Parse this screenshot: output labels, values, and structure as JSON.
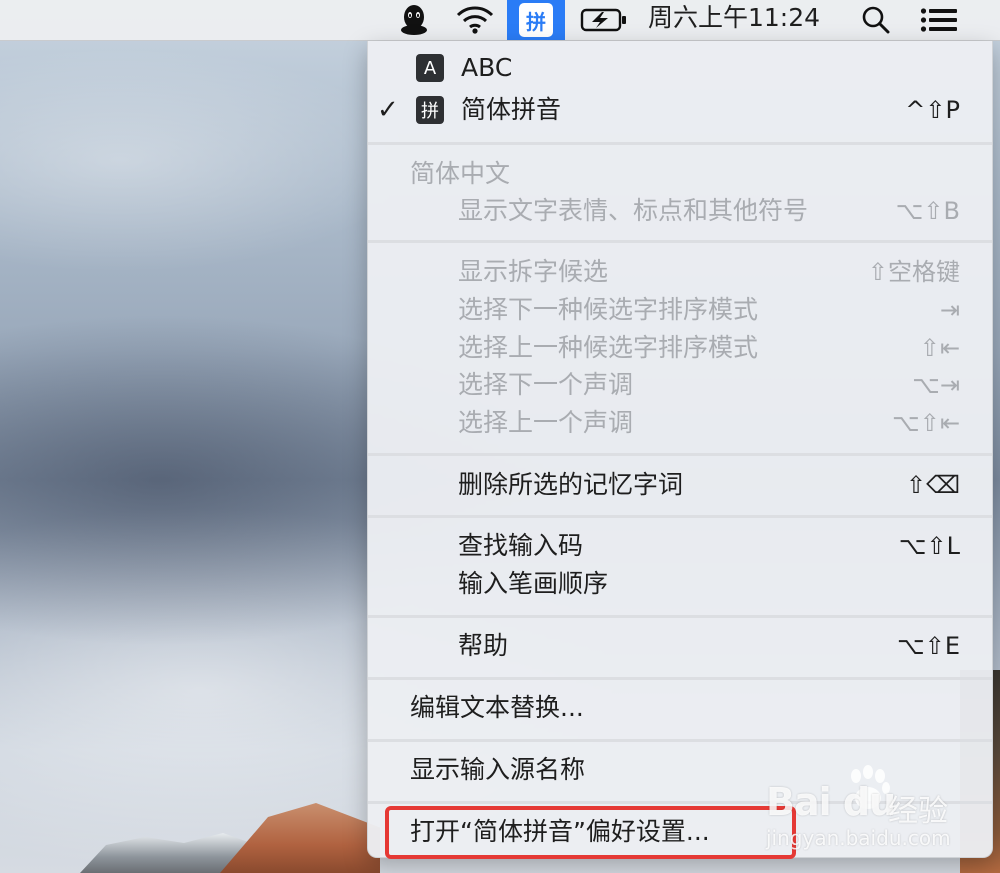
{
  "menubar": {
    "clock": "周六上午11:24",
    "ime_badge": "拼",
    "icons": [
      "qq-icon",
      "wifi-icon",
      "input-method-icon",
      "battery-charging-icon",
      "spotlight-search-icon",
      "notification-center-icon"
    ]
  },
  "menu": {
    "sources": [
      {
        "badge": "A",
        "label": "ABC",
        "shortcut": "",
        "checked": false
      },
      {
        "badge": "拼",
        "label": "简体拼音",
        "shortcut": "^⇧P",
        "checked": true
      }
    ],
    "section_header": "简体中文",
    "emoji_item": {
      "label": "显示文字表情、标点和其他符号",
      "shortcut": "⌥⇧B"
    },
    "candidate_items": [
      {
        "label": "显示拆字候选",
        "shortcut": "⇧空格键"
      },
      {
        "label": "选择下一种候选字排序模式",
        "shortcut": "⇥"
      },
      {
        "label": "选择上一种候选字排序模式",
        "shortcut": "⇧⇤"
      },
      {
        "label": "选择下一个声调",
        "shortcut": "⌥⇥"
      },
      {
        "label": "选择上一个声调",
        "shortcut": "⌥⇧⇤"
      }
    ],
    "delete_item": {
      "label": "删除所选的记忆字词",
      "shortcut": "⇧⌫"
    },
    "lookup_items": [
      {
        "label": "查找输入码",
        "shortcut": "⌥⇧L"
      },
      {
        "label": "输入笔画顺序",
        "shortcut": ""
      }
    ],
    "help_item": {
      "label": "帮助",
      "shortcut": "⌥⇧E"
    },
    "edit_replacements": "编辑文本替换...",
    "show_source_name": "显示输入源名称",
    "open_prefs": "打开“简体拼音”偏好设置..."
  },
  "watermark": {
    "brand": "Bai  du",
    "cn": "经验",
    "url": "jingyan.baidu.com"
  },
  "colors": {
    "highlight": "#e53935",
    "ime_blue": "#2a7cf6"
  }
}
